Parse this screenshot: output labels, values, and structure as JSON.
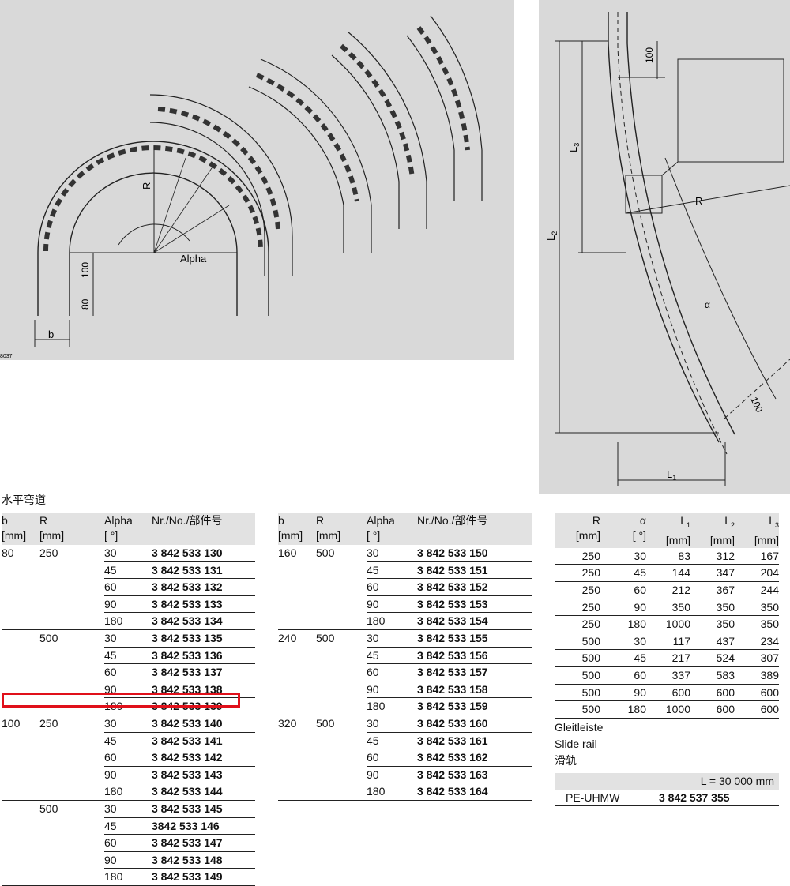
{
  "figure_left": {
    "code": "8037",
    "dim_100": "100",
    "dim_80": "80",
    "label_b": "b",
    "label_r": "R",
    "label_alpha": "Alpha"
  },
  "figure_right": {
    "dim_100_top": "100",
    "dim_100_bottom": "100",
    "label_l3": "L",
    "label_l3_sub": "3",
    "label_l2": "L",
    "label_l2_sub": "2",
    "label_l1": "L",
    "label_l1_sub": "1",
    "label_r": "R",
    "label_alpha": "α"
  },
  "section_title": "水平弯道",
  "table_headers": {
    "b": "b",
    "b_unit": "[mm]",
    "r": "R",
    "r_unit": "[mm]",
    "alpha": "Alpha",
    "alpha_unit": "[ °]",
    "nr": "Nr./No./部件号"
  },
  "table1": [
    {
      "b": "80",
      "r": "250",
      "rows": [
        [
          "30",
          "3 842 533 130"
        ],
        [
          "45",
          "3 842 533 131"
        ],
        [
          "60",
          "3 842 533 132"
        ],
        [
          "90",
          "3 842 533 133"
        ],
        [
          "180",
          "3 842 533 134"
        ]
      ]
    },
    {
      "b": "",
      "r": "500",
      "rows": [
        [
          "30",
          "3 842 533 135"
        ],
        [
          "45",
          "3 842 533 136"
        ],
        [
          "60",
          "3 842 533 137"
        ],
        [
          "90",
          "3 842 533 138"
        ],
        [
          "180",
          "3 842 533 139"
        ]
      ]
    },
    {
      "b": "100",
      "r": "250",
      "rows": [
        [
          "30",
          "3 842 533 140"
        ],
        [
          "45",
          "3 842 533 141"
        ],
        [
          "60",
          "3 842 533 142"
        ],
        [
          "90",
          "3 842 533 143"
        ],
        [
          "180",
          "3 842 533 144"
        ]
      ]
    },
    {
      "b": "",
      "r": "500",
      "rows": [
        [
          "30",
          "3 842 533 145"
        ],
        [
          "45",
          "3842 533 146"
        ],
        [
          "60",
          "3 842 533 147"
        ],
        [
          "90",
          "3 842 533 148"
        ],
        [
          "180",
          "3 842 533 149"
        ]
      ]
    }
  ],
  "table2": [
    {
      "b": "160",
      "r": "500",
      "rows": [
        [
          "30",
          "3 842 533 150"
        ],
        [
          "45",
          "3 842 533 151"
        ],
        [
          "60",
          "3 842 533 152"
        ],
        [
          "90",
          "3 842 533 153"
        ],
        [
          "180",
          "3 842 533 154"
        ]
      ]
    },
    {
      "b": "240",
      "r": "500",
      "rows": [
        [
          "30",
          "3 842 533 155"
        ],
        [
          "45",
          "3 842 533 156"
        ],
        [
          "60",
          "3 842 533 157"
        ],
        [
          "90",
          "3 842 533 158"
        ],
        [
          "180",
          "3 842 533 159"
        ]
      ]
    },
    {
      "b": "320",
      "r": "500",
      "rows": [
        [
          "30",
          "3 842 533 160"
        ],
        [
          "45",
          "3 842 533 161"
        ],
        [
          "60",
          "3 842 533 162"
        ],
        [
          "90",
          "3 842 533 163"
        ],
        [
          "180",
          "3 842 533 164"
        ]
      ]
    }
  ],
  "table3": {
    "headers": [
      [
        "R",
        "[mm]",
        ""
      ],
      [
        "α",
        "[ °]",
        ""
      ],
      [
        "L",
        "[mm]",
        "1"
      ],
      [
        "L",
        "[mm]",
        "2"
      ],
      [
        "L",
        "[mm]",
        "3"
      ]
    ],
    "rows": [
      [
        "250",
        "30",
        "83",
        "312",
        "167"
      ],
      [
        "250",
        "45",
        "144",
        "347",
        "204"
      ],
      [
        "250",
        "60",
        "212",
        "367",
        "244"
      ],
      [
        "250",
        "90",
        "350",
        "350",
        "350"
      ],
      [
        "250",
        "180",
        "1000",
        "350",
        "350"
      ],
      [
        "500",
        "30",
        "117",
        "437",
        "234"
      ],
      [
        "500",
        "45",
        "217",
        "524",
        "307"
      ],
      [
        "500",
        "60",
        "337",
        "583",
        "389"
      ],
      [
        "500",
        "90",
        "600",
        "600",
        "600"
      ],
      [
        "500",
        "180",
        "1000",
        "600",
        "600"
      ]
    ]
  },
  "slide_rail": {
    "label_de": "Gleitleiste",
    "label_en": "Slide rail",
    "label_cn": "滑轨",
    "length": "L = 30 000 mm",
    "material": "PE-UHMW",
    "part_no": "3 842 537 355"
  },
  "highlight_part": "3 842 533 139"
}
